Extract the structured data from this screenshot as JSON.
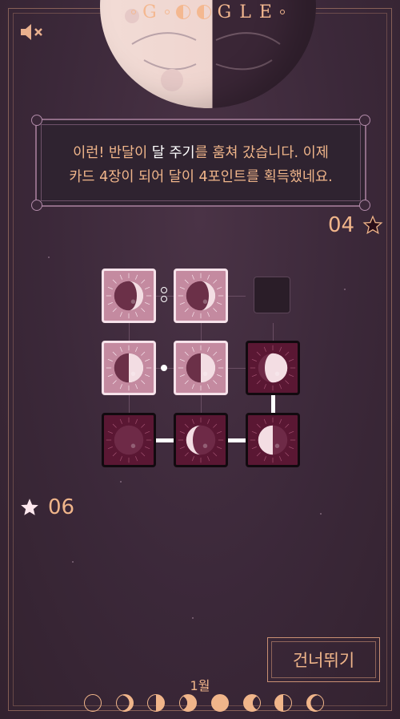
{
  "header": {
    "title_letters": [
      "G",
      "G",
      "L",
      "E"
    ]
  },
  "message": {
    "line1_prefix": "이런! 반달이 ",
    "line1_highlight": "달 주기",
    "line1_suffix": "를 훔쳐 갔습니다. 이제",
    "line2": "카드 4장이 되어 달이 4포인트를 획득했네요."
  },
  "scores": {
    "moon_score": "04",
    "player_score": "06"
  },
  "skip_button": {
    "label": "건너뛰기"
  },
  "month": {
    "label": "1월"
  },
  "colors": {
    "accent": "#f0b58a",
    "light_card": "#c48aa0",
    "dark_card": "#5a1733",
    "background": "#3b2839"
  },
  "board": {
    "cards": [
      {
        "row": 0,
        "col": 0,
        "owner": "light",
        "phase": "waxing-crescent"
      },
      {
        "row": 0,
        "col": 1,
        "owner": "light",
        "phase": "waxing-crescent"
      },
      {
        "row": 0,
        "col": 2,
        "owner": "empty",
        "phase": "none"
      },
      {
        "row": 1,
        "col": 0,
        "owner": "light",
        "phase": "first-quarter"
      },
      {
        "row": 1,
        "col": 1,
        "owner": "light",
        "phase": "first-quarter"
      },
      {
        "row": 1,
        "col": 2,
        "owner": "dark",
        "phase": "waxing-gibbous"
      },
      {
        "row": 2,
        "col": 0,
        "owner": "dark",
        "phase": "new-moon"
      },
      {
        "row": 2,
        "col": 1,
        "owner": "dark",
        "phase": "waning-crescent"
      },
      {
        "row": 2,
        "col": 2,
        "owner": "dark",
        "phase": "last-quarter"
      }
    ]
  },
  "phase_strip": [
    "new-moon",
    "waxing-crescent",
    "first-quarter",
    "waxing-gibbous",
    "full-moon",
    "waning-gibbous",
    "last-quarter",
    "waning-crescent"
  ]
}
